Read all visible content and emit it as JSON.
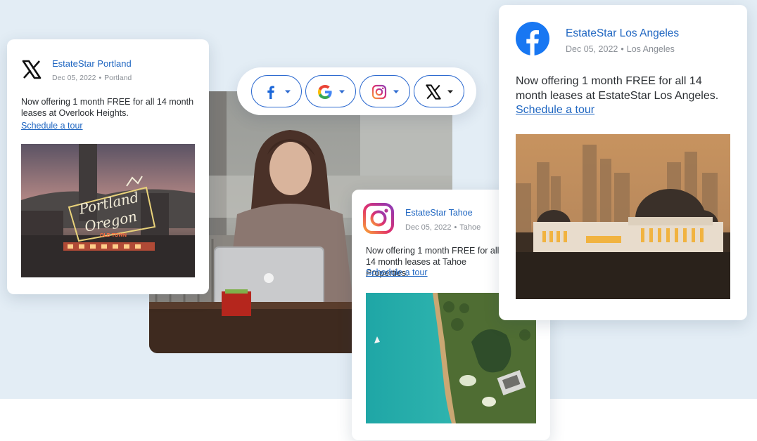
{
  "cards": {
    "portland": {
      "brand": "EstateStar Portland",
      "date": "Dec 05, 2022",
      "separator": "•",
      "location": "Portland",
      "body": "Now offering 1 month FREE for all 14 month leases at Overlook Heights.",
      "link": "Schedule a tour",
      "icon": "x-logo-icon",
      "sign_text": [
        "Portland",
        "Oregon",
        "OLD TOWN"
      ]
    },
    "tahoe": {
      "brand": "EstateStar Tahoe",
      "date": "Dec 05, 2022",
      "separator": "•",
      "location": "Tahoe",
      "body": "Now offering 1 month FREE for all 14 month leases at Tahoe Properties.",
      "link": "Schedule a tour",
      "icon": "instagram-logo-icon"
    },
    "la": {
      "brand": "EstateStar Los Angeles",
      "date": "Dec 05, 2022",
      "separator": "•",
      "location": "Los Angeles",
      "body": "Now offering 1 month FREE for all 14 month leases at EstateStar Los Angeles.",
      "link": "Schedule a tour",
      "icon": "facebook-logo-icon"
    }
  },
  "social_selector": {
    "buttons": [
      {
        "name": "facebook",
        "icon": "facebook-f-icon"
      },
      {
        "name": "google",
        "icon": "google-g-icon"
      },
      {
        "name": "instagram",
        "icon": "instagram-icon"
      },
      {
        "name": "x",
        "icon": "x-icon"
      }
    ],
    "caret_icon": "caret-down-icon"
  },
  "colors": {
    "background_band": "#e3edf5",
    "brand_blue": "#1f66c1",
    "button_border": "#2e6bd0",
    "facebook": "#1877f2",
    "text": "#2b2f33",
    "meta": "#8a8f96"
  }
}
